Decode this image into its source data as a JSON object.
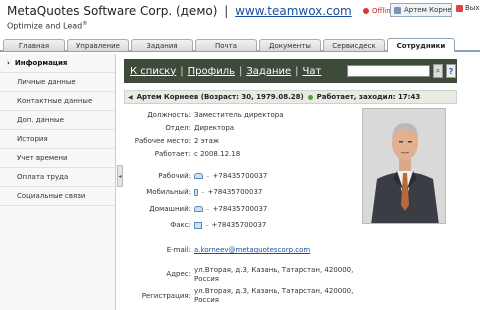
{
  "header": {
    "company": "MetaQuotes Software Corp. (демо)",
    "separator": "|",
    "site_link": "www.teamwox.com",
    "tagline": "Optimize and Lead",
    "tagline_mark": "®",
    "status": "Offline",
    "user": "Артем Корнеев",
    "logout": "Выход"
  },
  "tabs": [
    {
      "label": "Главная"
    },
    {
      "label": "Управление"
    },
    {
      "label": "Задания"
    },
    {
      "label": "Почта"
    },
    {
      "label": "Документы"
    },
    {
      "label": "Сервисдеск"
    },
    {
      "label": "Сотрудники"
    }
  ],
  "sidebar": {
    "items": [
      {
        "label": "Информация"
      },
      {
        "label": "Личные данные"
      },
      {
        "label": "Контактные данные"
      },
      {
        "label": "Доп. данные"
      },
      {
        "label": "История"
      },
      {
        "label": "Учет времени"
      },
      {
        "label": "Оплата труда"
      },
      {
        "label": "Социальные связи"
      }
    ],
    "active_arrow": "›",
    "collapse_glyph": "◂"
  },
  "actions": {
    "back": "К списку",
    "profile": "Профиль",
    "task": "Задание",
    "chat": "Чат",
    "sep": "|",
    "search_glyph": "⌕",
    "help_glyph": "?"
  },
  "person": {
    "toggle_glyph": "◀",
    "title": "Артем Корнеев (Возраст: 30, 1979.08.28)",
    "status": "Работает, заходил: 17:43"
  },
  "info": {
    "position_label": "Должность:",
    "position": "Заместитель директора",
    "department_label": "Отдел:",
    "department": "Директора",
    "workplace_label": "Рабочее место:",
    "workplace": "2 этаж",
    "works_since_label": "Работает:",
    "works_since": "с 2008.12.18",
    "work_phone_label": "Рабочий:",
    "work_phone": "+78435700037",
    "mobile_label": "Мобильный:",
    "mobile": "+78435700037",
    "home_label": "Домашний:",
    "home": "+78435700037",
    "fax_label": "Факс:",
    "fax": "+78435700037",
    "dash": "–",
    "email_label": "E-mail:",
    "email": "a.korneev@metaquotescorp.com",
    "address_label": "Адрес:",
    "address_line1": "ул.Вторая, д.3, Казань, Татарстан, 420000,",
    "address_line2": "Россия",
    "registration_label": "Регистрация:",
    "registration_line1": "ул.Вторая, д.3, Казань, Татарстан, 420000,",
    "registration_line2": "Россия"
  }
}
